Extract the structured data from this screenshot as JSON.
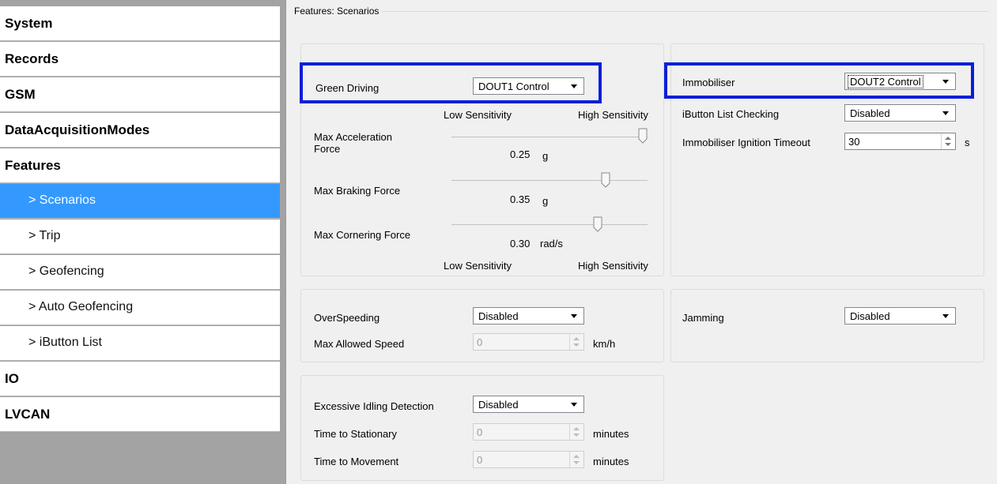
{
  "sidebar": {
    "items": [
      {
        "label": "System"
      },
      {
        "label": "Records"
      },
      {
        "label": "GSM"
      },
      {
        "label": "DataAcquisitionModes"
      },
      {
        "label": "Features"
      },
      {
        "label": "> Scenarios"
      },
      {
        "label": "> Trip"
      },
      {
        "label": "> Geofencing"
      },
      {
        "label": "> Auto Geofencing"
      },
      {
        "label": "> iButton List"
      },
      {
        "label": "IO"
      },
      {
        "label": "LVCAN"
      }
    ],
    "active": "> Scenarios"
  },
  "page": {
    "title": "Features: Scenarios"
  },
  "green_driving": {
    "label": "Green Driving",
    "value": "DOUT1 Control",
    "low_sens": "Low Sensitivity",
    "high_sens": "High Sensitivity",
    "sliders": [
      {
        "label": "Max Acceleration Force",
        "label_line1": "Max Acceleration",
        "label_line2": "Force",
        "value": "0.25",
        "unit": "g",
        "level": 1.0
      },
      {
        "label": "Max Braking Force",
        "value": "0.35",
        "unit": "g",
        "level": 0.8
      },
      {
        "label": "Max Cornering Force",
        "value": "0.30",
        "unit": "rad/s",
        "level": 0.76
      }
    ]
  },
  "immobiliser": {
    "label": "Immobiliser",
    "value": "DOUT2 Control",
    "ibutton_label": "iButton List Checking",
    "ibutton_value": "Disabled",
    "timeout_label": "Immobiliser Ignition Timeout",
    "timeout_value": "30",
    "timeout_unit": "s"
  },
  "overspeeding": {
    "label": "OverSpeeding",
    "value": "Disabled",
    "max_speed_label": "Max Allowed Speed",
    "max_speed_value": "0",
    "max_speed_unit": "km/h"
  },
  "jamming": {
    "label": "Jamming",
    "value": "Disabled"
  },
  "idling": {
    "label": "Excessive Idling Detection",
    "value": "Disabled",
    "stationary_label": "Time to Stationary",
    "stationary_value": "0",
    "stationary_unit": "minutes",
    "movement_label": "Time to Movement",
    "movement_value": "0",
    "movement_unit": "minutes"
  },
  "colors": {
    "selection": "#3399ff",
    "highlight": "#0a1fd8",
    "sidebar_bg": "#a3a3a3"
  }
}
